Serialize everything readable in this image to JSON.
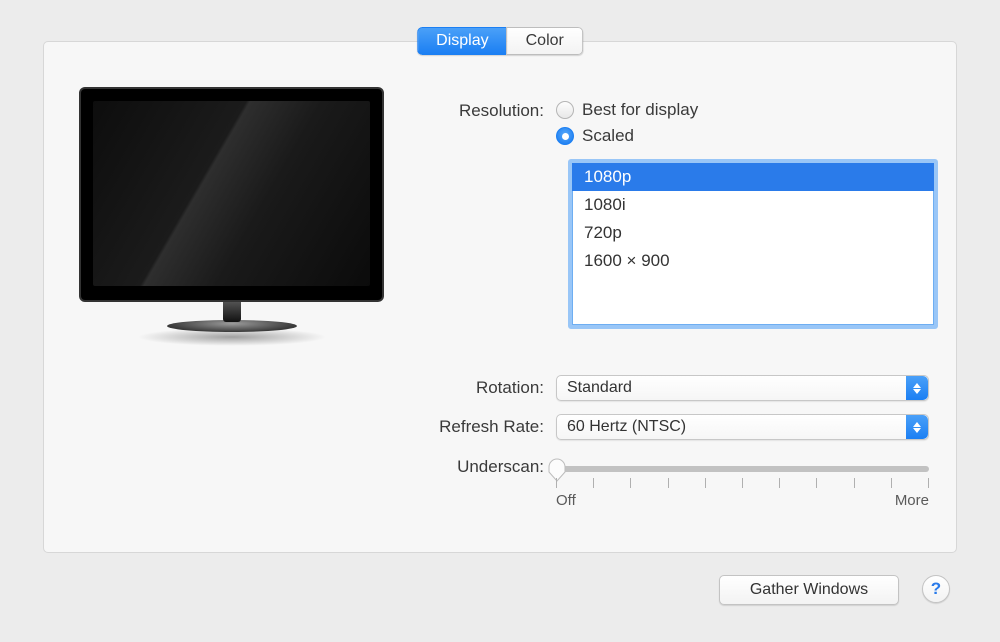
{
  "tabs": {
    "display": "Display",
    "color": "Color",
    "active": "display"
  },
  "labels": {
    "resolution": "Resolution:",
    "rotation": "Rotation:",
    "refresh": "Refresh Rate:",
    "underscan": "Underscan:"
  },
  "resolution": {
    "options": {
      "best": "Best for display",
      "scaled": "Scaled"
    },
    "selected": "scaled",
    "scaled_list": [
      "1080p",
      "1080i",
      "720p",
      "1600 × 900"
    ],
    "scaled_selected": "1080p"
  },
  "rotation": {
    "value": "Standard"
  },
  "refresh": {
    "value": "60 Hertz (NTSC)"
  },
  "underscan": {
    "min_label": "Off",
    "max_label": "More",
    "ticks": 11,
    "value": 0
  },
  "buttons": {
    "gather": "Gather Windows",
    "help": "?"
  }
}
